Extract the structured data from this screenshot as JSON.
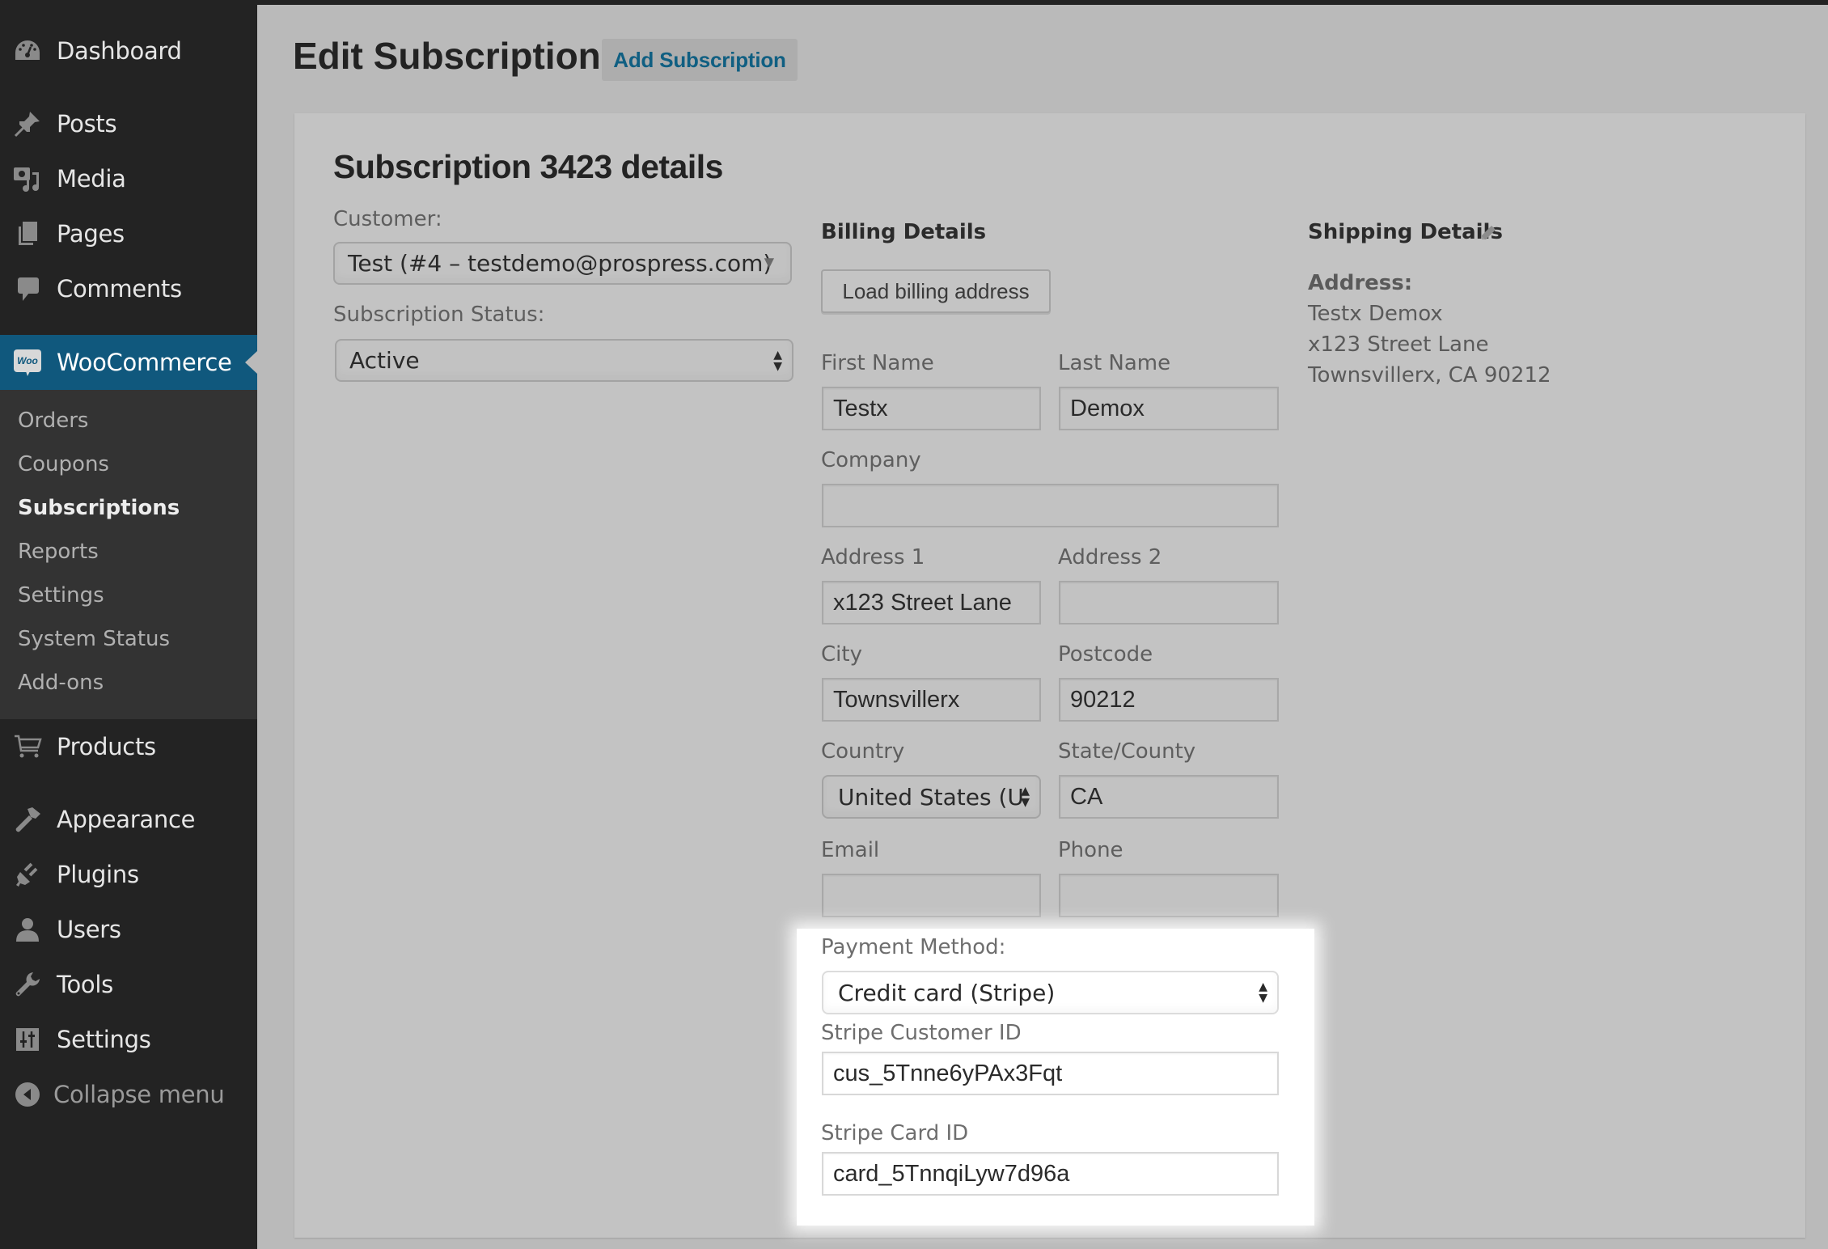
{
  "sidebar": {
    "items": [
      {
        "label": "Dashboard",
        "icon": "dashboard-icon"
      },
      {
        "label": "Posts",
        "icon": "pushpin-icon"
      },
      {
        "label": "Media",
        "icon": "media-icon"
      },
      {
        "label": "Pages",
        "icon": "pages-icon"
      },
      {
        "label": "Comments",
        "icon": "comment-icon"
      },
      {
        "label": "WooCommerce",
        "icon": "woo-icon",
        "active": true
      },
      {
        "label": "Products",
        "icon": "cart-icon"
      },
      {
        "label": "Appearance",
        "icon": "paintbrush-icon"
      },
      {
        "label": "Plugins",
        "icon": "plug-icon"
      },
      {
        "label": "Users",
        "icon": "user-icon"
      },
      {
        "label": "Tools",
        "icon": "wrench-icon"
      },
      {
        "label": "Settings",
        "icon": "settings-icon"
      },
      {
        "label": "Collapse menu",
        "icon": "collapse-icon"
      }
    ],
    "woo_icon_text": "Woo",
    "submenu": [
      {
        "label": "Orders"
      },
      {
        "label": "Coupons"
      },
      {
        "label": "Subscriptions",
        "current": true
      },
      {
        "label": "Reports"
      },
      {
        "label": "Settings"
      },
      {
        "label": "System Status"
      },
      {
        "label": "Add-ons"
      }
    ]
  },
  "header": {
    "title": "Edit Subscription",
    "add_button": "Add Subscription"
  },
  "panel": {
    "title": "Subscription 3423 details",
    "customer": {
      "label": "Customer:",
      "value": "Test (#4 – testdemo@prospress.com)"
    },
    "status": {
      "label": "Subscription Status:",
      "value": "Active"
    },
    "billing": {
      "heading": "Billing Details",
      "load_button": "Load billing address",
      "first_name": {
        "label": "First Name",
        "value": "Testx"
      },
      "last_name": {
        "label": "Last Name",
        "value": "Demox"
      },
      "company": {
        "label": "Company",
        "value": ""
      },
      "address1": {
        "label": "Address 1",
        "value": "x123 Street Lane"
      },
      "address2": {
        "label": "Address 2",
        "value": ""
      },
      "city": {
        "label": "City",
        "value": "Townsvillerx"
      },
      "postcode": {
        "label": "Postcode",
        "value": "90212"
      },
      "country": {
        "label": "Country",
        "value": "United States (U"
      },
      "state": {
        "label": "State/County",
        "value": "CA"
      },
      "email": {
        "label": "Email",
        "value": ""
      },
      "phone": {
        "label": "Phone",
        "value": ""
      },
      "payment_method": {
        "label": "Payment Method:",
        "value": "Credit card (Stripe)"
      },
      "stripe_customer_id": {
        "label": "Stripe Customer ID",
        "value": "cus_5Tnne6yPAx3Fqt"
      },
      "stripe_card_id": {
        "label": "Stripe Card ID",
        "value": "card_5TnnqiLyw7d96a"
      }
    },
    "shipping": {
      "heading": "Shipping Details",
      "address_label": "Address:",
      "address_lines": [
        "Testx Demox",
        "x123 Street Lane",
        "Townsvillerx, CA 90212"
      ]
    }
  },
  "colors": {
    "sidebar_bg": "#232323",
    "submenu_bg": "#333333",
    "active_menu": "#10587d",
    "link": "#105f82",
    "page_bg": "#bababa",
    "panel_bg": "#c3c3c3",
    "highlight_bg": "#ffffff"
  }
}
